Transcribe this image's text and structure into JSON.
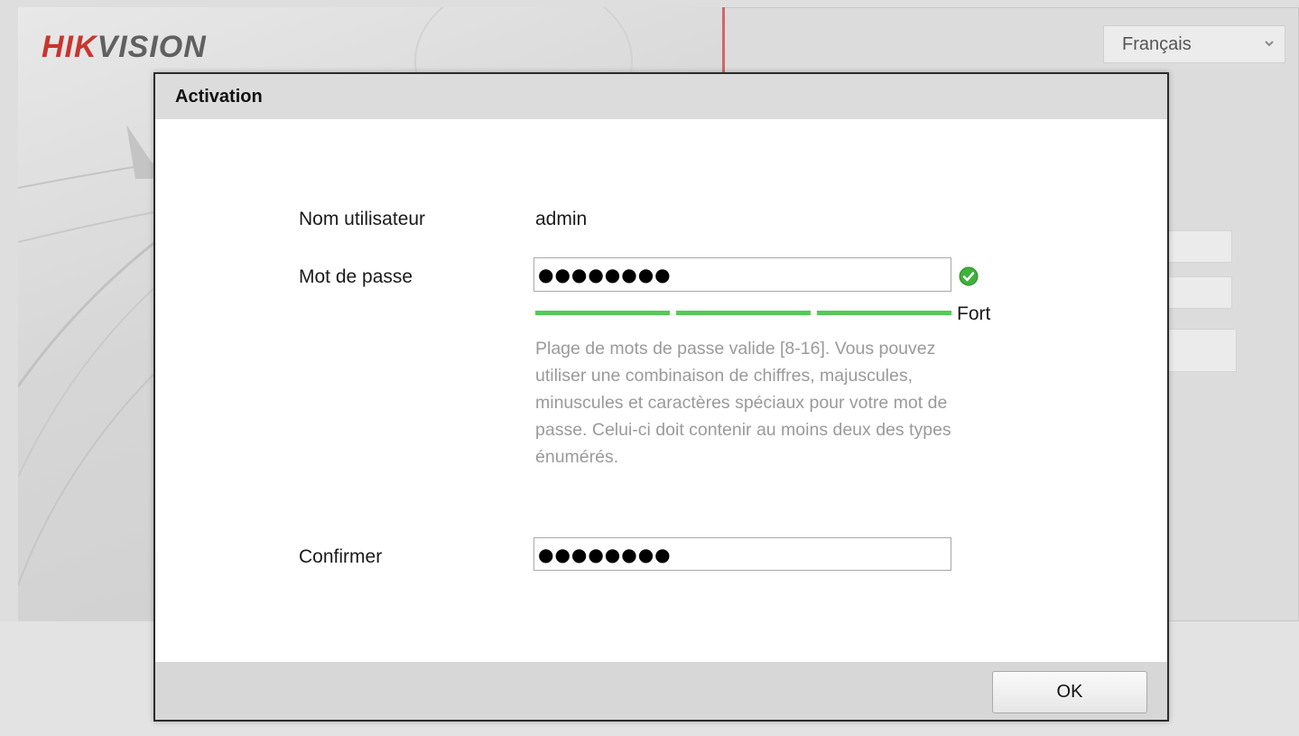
{
  "background": {
    "logo": {
      "part1": "HIK",
      "part2": "VISION"
    },
    "language_select": {
      "value": "Français",
      "icon": "chevron-down-icon"
    }
  },
  "dialog": {
    "title": "Activation",
    "username": {
      "label": "Nom utilisateur",
      "value": "admin"
    },
    "password": {
      "label": "Mot de passe",
      "value": "●●●●●●●●",
      "valid_icon": "check-circle-icon",
      "strength_label": "Fort",
      "strength_level": 3,
      "strength_max": 3,
      "hint": "Plage de mots de passe valide [8-16]. Vous pouvez utiliser une combinaison de chiffres, majuscules, minuscules et caractères spéciaux pour votre mot de passe. Celui-ci doit contenir au moins deux des types énumérés."
    },
    "confirm": {
      "label": "Confirmer",
      "value": "●●●●●●●●"
    },
    "ok_label": "OK"
  },
  "colors": {
    "brand_red": "#c8352f",
    "strength_green": "#55c957",
    "valid_green": "#3fb03c"
  }
}
